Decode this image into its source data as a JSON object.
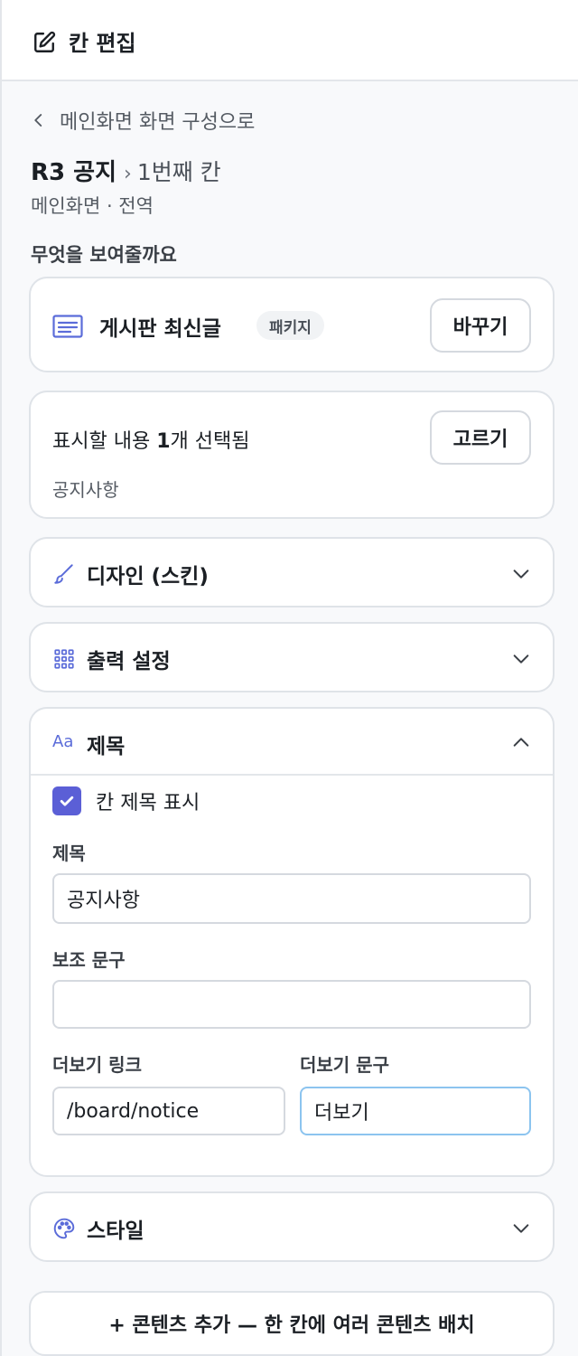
{
  "header": {
    "title": "칸 편집",
    "icon": "edit-icon"
  },
  "back": {
    "label": "메인화면 화면 구성으로"
  },
  "crumb": {
    "name": "R3 공지",
    "separator": "›",
    "slot": "1번째 칸"
  },
  "location": "메인화면 · 전역",
  "content_section": {
    "label": "무엇을 보여줄까요"
  },
  "source": {
    "title": "게시판 최신글",
    "badge": "패키지",
    "change_button": "바꾸기"
  },
  "selection": {
    "prefix": "표시할 내용 ",
    "count": "1",
    "suffix": "개 선택됨",
    "item": "공지사항",
    "choose_button": "고르기"
  },
  "accordions": {
    "design": {
      "title": "디자인 (스킨)",
      "icon": "brush-icon"
    },
    "output": {
      "title": "출력 설정",
      "icon": "grid-icon"
    },
    "title": {
      "title": "제목",
      "icon_text": "Aa"
    },
    "style": {
      "title": "스타일",
      "icon": "palette-icon"
    }
  },
  "title_panel": {
    "show_title_checkbox": {
      "label": "칸 제목 표시",
      "checked": true
    },
    "title_field": {
      "label": "제목",
      "value": "공지사항"
    },
    "subtitle_field": {
      "label": "보조 문구",
      "value": ""
    },
    "more_link_field": {
      "label": "더보기 링크",
      "value": "/board/notice"
    },
    "more_text_field": {
      "label": "더보기 문구",
      "value": "더보기"
    }
  },
  "add_content_button": "+ 콘텐츠 추가 — 한 칸에 여러 콘텐츠 배치",
  "colors": {
    "accent": "#5b5fd6",
    "icon_blue": "#5b6cd9",
    "focus_border": "#8cc4ef"
  }
}
